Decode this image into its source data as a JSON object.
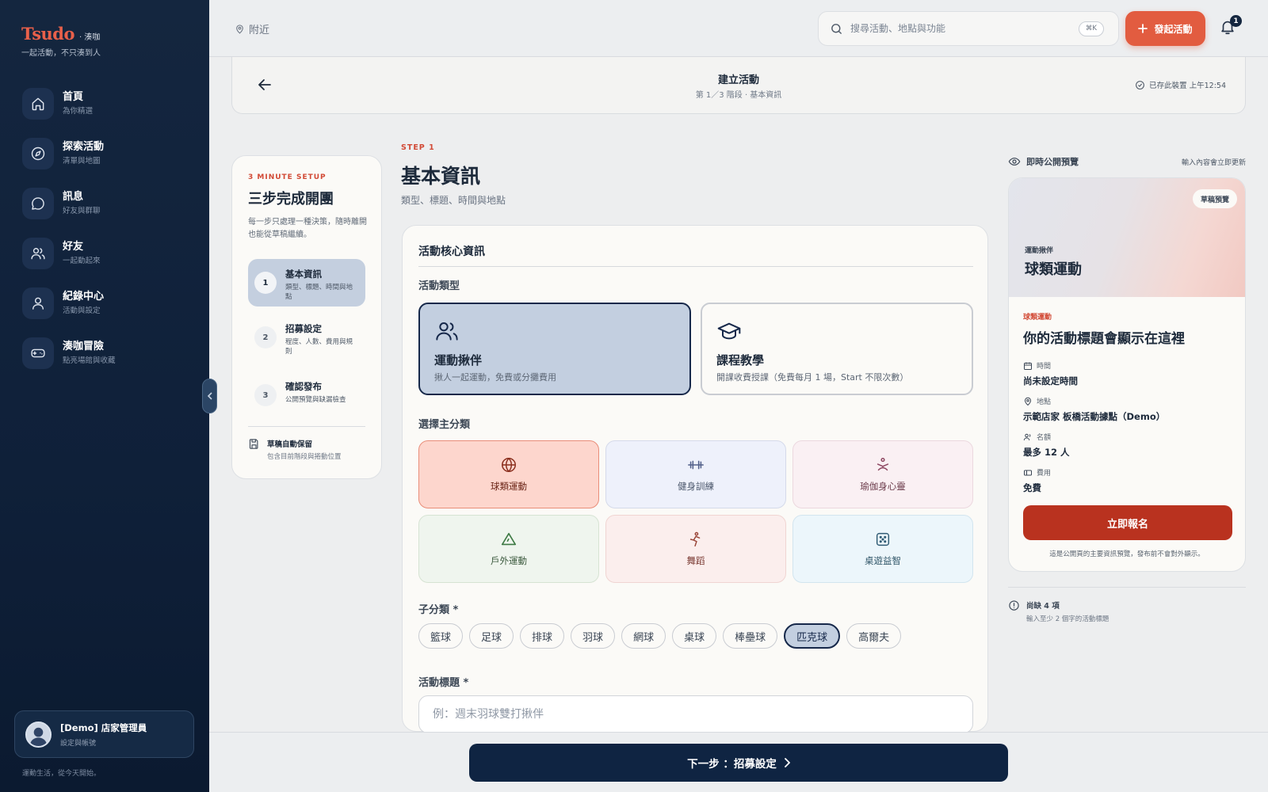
{
  "sidebar": {
    "brand_name": "Tsudo",
    "brand_sub": "· 湊咖",
    "tagline": "一起活動，不只湊到人",
    "items": [
      {
        "label": "首頁",
        "sub": "為你精選",
        "icon": "home-icon"
      },
      {
        "label": "探索活動",
        "sub": "清單與地圖",
        "icon": "compass-icon"
      },
      {
        "label": "訊息",
        "sub": "好友與群聊",
        "icon": "message-icon"
      },
      {
        "label": "好友",
        "sub": "一起動起來",
        "icon": "friends-icon"
      },
      {
        "label": "紀錄中心",
        "sub": "活動與設定",
        "icon": "user-icon"
      },
      {
        "label": "湊咖冒險",
        "sub": "點亮場館與收藏",
        "icon": "gamepad-icon"
      }
    ],
    "user": {
      "name": "[Demo] 店家管理員",
      "sub": "設定與帳號"
    },
    "footer": "運動生活，從今天開始。"
  },
  "topbar": {
    "nearby": "附近",
    "search_placeholder": "搜尋活動、地點與功能",
    "shortcut": "⌘K",
    "create_label": "發起活動",
    "notification_count": "1"
  },
  "header": {
    "title": "建立活動",
    "subtitle": "第 1／3 階段 · 基本資訊",
    "saved_status": "已存此裝置 上午12:54"
  },
  "steps": {
    "eyebrow": "3 MINUTE SETUP",
    "title": "三步完成開團",
    "description": "每一步只處理一種決策，隨時離開也能從草稿繼續。",
    "items": [
      {
        "num": "1",
        "title": "基本資訊",
        "sub": "類型、標題、時間與地點"
      },
      {
        "num": "2",
        "title": "招募設定",
        "sub": "程度、人數、費用與規則"
      },
      {
        "num": "3",
        "title": "確認發布",
        "sub": "公開預覽與缺漏檢查"
      }
    ],
    "autosave_title": "草稿自動保留",
    "autosave_sub": "包含目前階段與捲動位置"
  },
  "main": {
    "eyebrow": "STEP 1",
    "title": "基本資訊",
    "subtitle": "類型、標題、時間與地點",
    "card_title": "活動核心資訊",
    "type_label": "活動類型",
    "types": [
      {
        "title": "運動揪伴",
        "sub": "揪人一起運動，免費或分攤費用",
        "icon": "group-icon"
      },
      {
        "title": "課程教學",
        "sub": "開課收費授課（免費每月 1 場，Start 不限次數）",
        "icon": "graduation-cap-icon"
      }
    ],
    "category_label": "選擇主分類",
    "categories": [
      {
        "label": "球類運動",
        "icon": "ball-icon"
      },
      {
        "label": "健身訓練",
        "icon": "dumbbell-icon"
      },
      {
        "label": "瑜伽身心靈",
        "icon": "yoga-icon"
      },
      {
        "label": "戶外運動",
        "icon": "mountain-icon"
      },
      {
        "label": "舞蹈",
        "icon": "dance-icon"
      },
      {
        "label": "桌遊益智",
        "icon": "dice-icon"
      }
    ],
    "sub_label": "子分類 *",
    "subcategories": [
      "籃球",
      "足球",
      "排球",
      "羽球",
      "網球",
      "桌球",
      "棒壘球",
      "匹克球",
      "高爾夫"
    ],
    "selected_subcategory": "匹克球",
    "title_label": "活動標題 *",
    "title_placeholder": "例：週末羽球雙打揪伴"
  },
  "next_button": "下一步 ：招募設定",
  "preview": {
    "label": "即時公開預覽",
    "hint": "輸入內容會立即更新",
    "badge": "草稿預覽",
    "hero_sub": "運動揪伴",
    "hero_title": "球類運動",
    "category": "球類運動",
    "title": "你的活動標題會顯示在這裡",
    "rows": [
      {
        "label": "時間",
        "value": "尚未設定時間",
        "icon": "calendar-icon"
      },
      {
        "label": "地點",
        "value": "示範店家 板橋活動據點（Demo）",
        "icon": "location-icon"
      },
      {
        "label": "名額",
        "value": "最多 12 人",
        "icon": "people-icon"
      },
      {
        "label": "費用",
        "value": "免費",
        "icon": "ticket-icon"
      }
    ],
    "cta": "立即報名",
    "footnote": "這是公開頁的主要資訊預覽，發布前不會對外顯示。",
    "missing_title": "尚缺 4 項",
    "missing_sub": "輸入至少 2 個字的活動標題"
  },
  "colors": {
    "sidebar_bg": "#14263f",
    "accent": "#e25c40",
    "primary": "#0f2442",
    "cta": "#b9321f"
  }
}
